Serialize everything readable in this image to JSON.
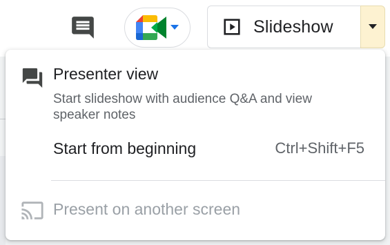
{
  "toolbar": {
    "comments_icon": "comment-icon",
    "meet_icon": "google-meet-icon",
    "meet_dropdown_icon": "caret-down-icon",
    "slideshow_icon": "play-square-icon",
    "slideshow_label": "Slideshow",
    "slideshow_dropdown_icon": "caret-down-icon",
    "dropdown_highlight_color": "#fdf2d1"
  },
  "menu": {
    "items": [
      {
        "icon": "presenter-view-icon",
        "title": "Presenter view",
        "description": "Start slideshow with audience Q&A and view speaker notes",
        "enabled": true
      },
      {
        "title": "Start from beginning",
        "shortcut": "Ctrl+Shift+F5",
        "enabled": true
      },
      {
        "icon": "cast-icon",
        "title": "Present on another screen",
        "enabled": false
      }
    ]
  }
}
